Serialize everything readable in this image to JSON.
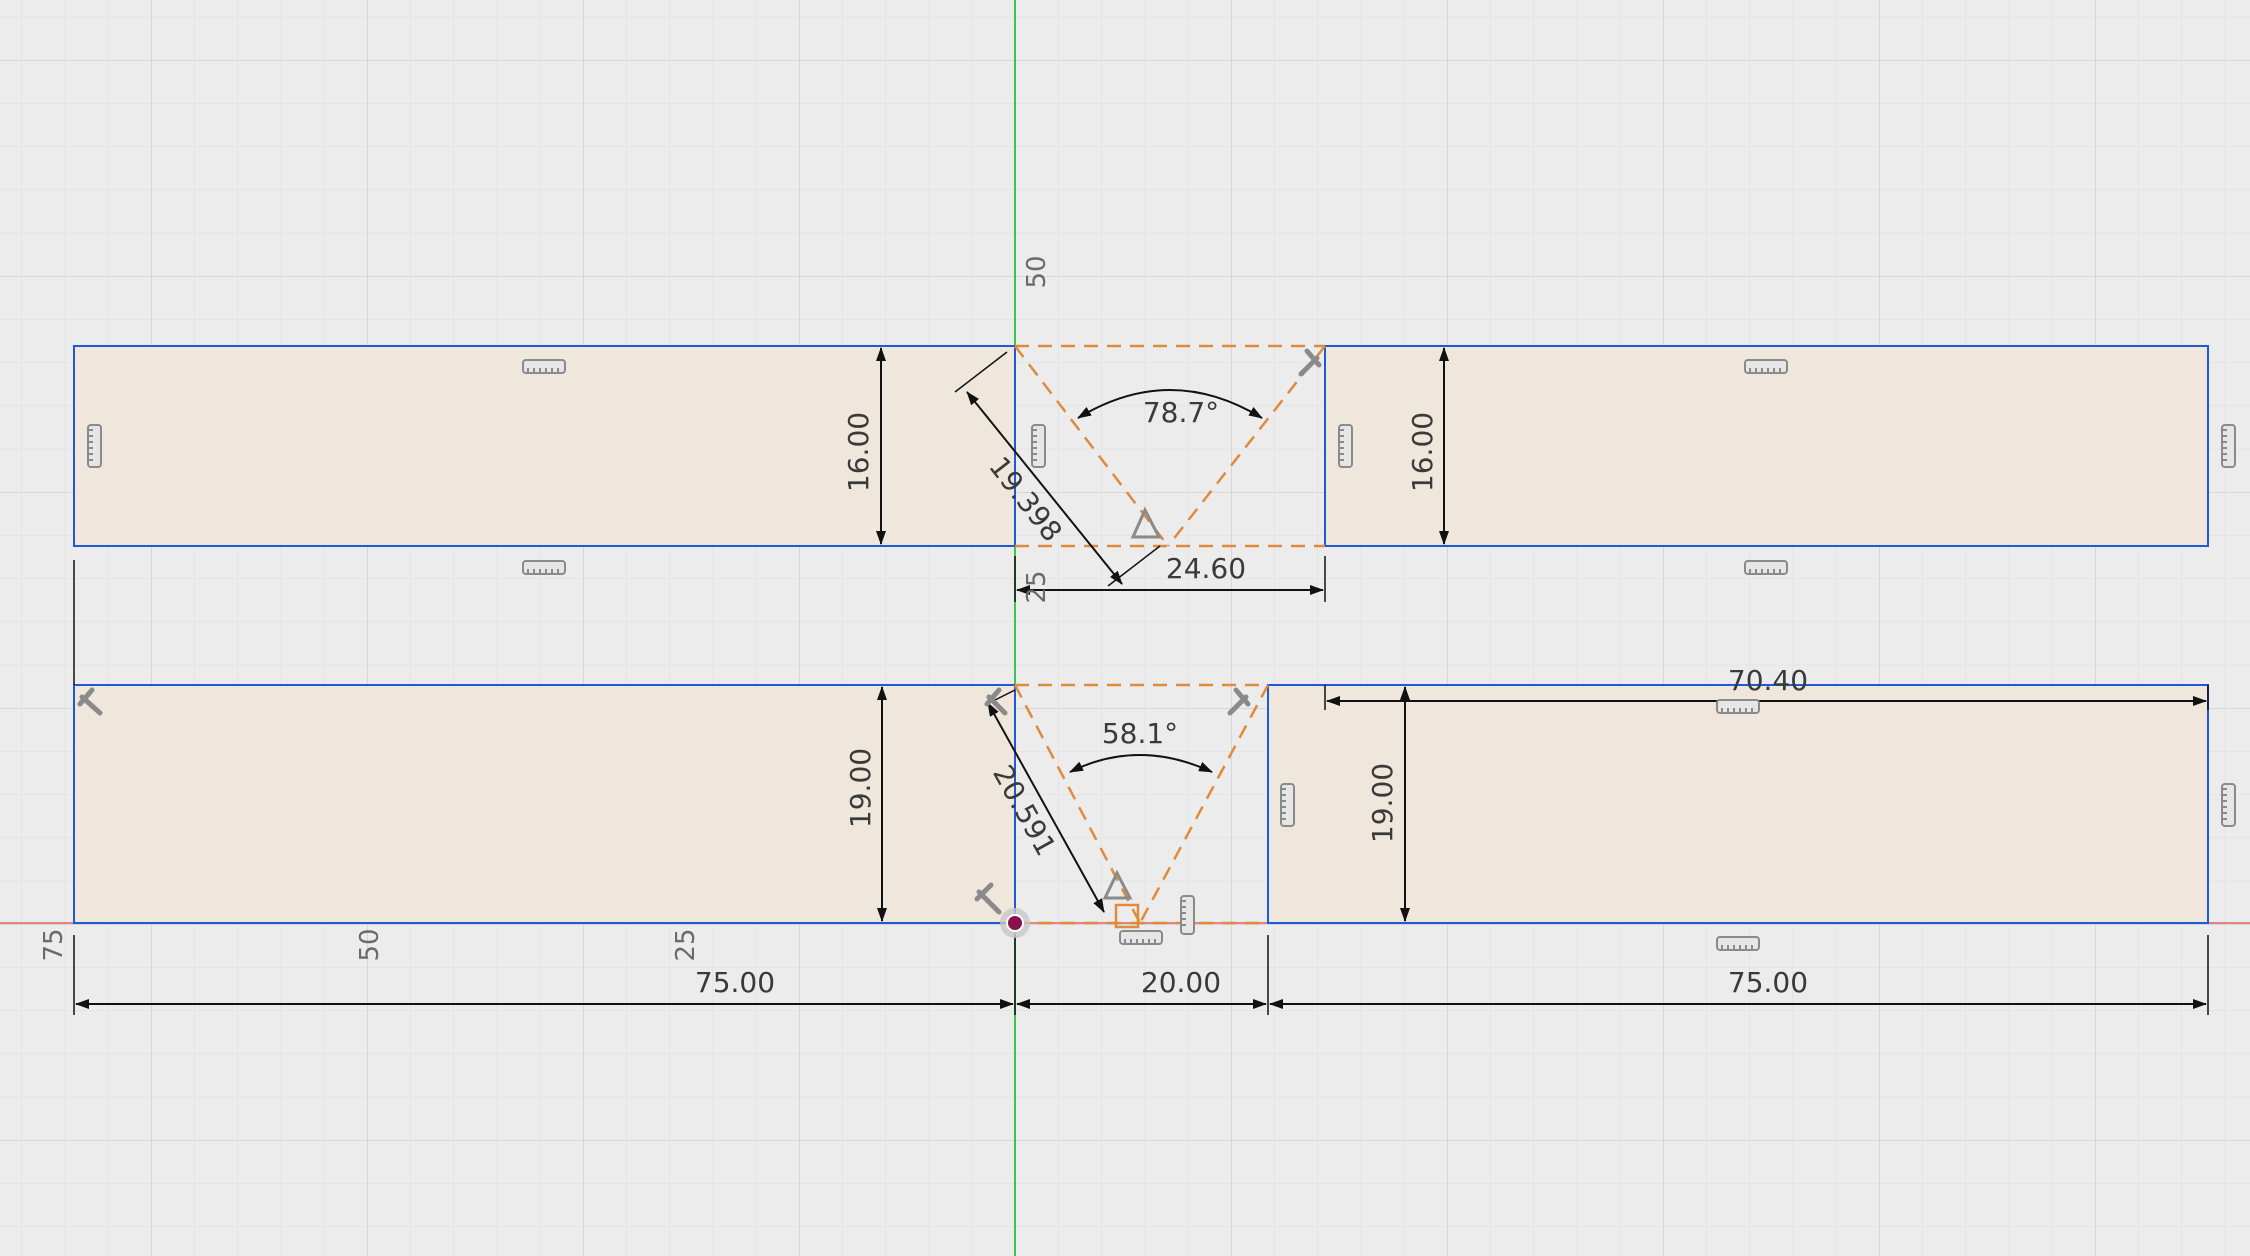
{
  "sketch": {
    "axis_labels": {
      "x_75": "75",
      "x_50": "50",
      "x_25": "25",
      "y_50": "50",
      "y_25": "25"
    },
    "dimensions": {
      "d_75_left": "75.00",
      "d_20": "20.00",
      "d_75_right": "75.00",
      "d_70_40": "70.40",
      "d_24_60": "24.60",
      "d_16_left": "16.00",
      "d_16_right": "16.00",
      "d_19_left": "19.00",
      "d_19_right": "19.00",
      "d_19_398": "19.398",
      "d_20_591": "20.591",
      "angle_top": "78.7°",
      "angle_bottom": "58.1°"
    },
    "colors": {
      "background": "#ececec",
      "grid_minor": "#dcdcdc",
      "grid_major": "#cfcfcf",
      "profile_fill": "#efe6dc",
      "sketch_line": "#1f5ad6",
      "construction": "#e08a3c",
      "dimension": "#111111",
      "x_axis": "#e06060",
      "y_axis": "#3cc44c",
      "origin": "#8a1050"
    }
  }
}
